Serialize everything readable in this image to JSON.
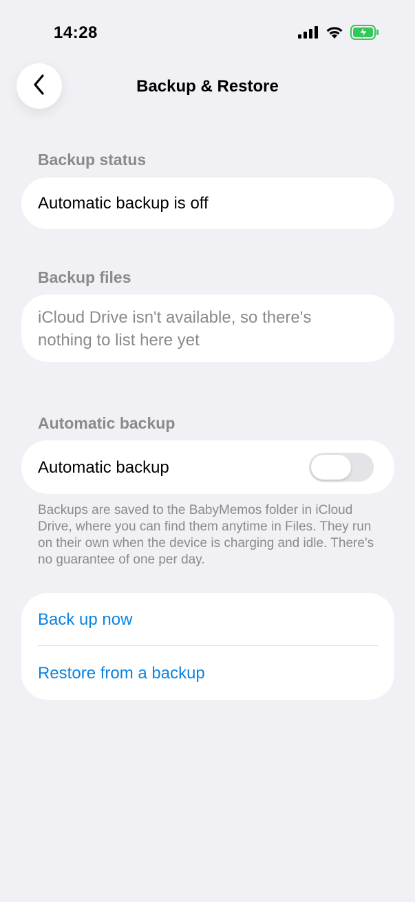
{
  "status_bar": {
    "time": "14:28",
    "icons": [
      "signal-icon",
      "wifi-icon",
      "battery-charging-icon"
    ],
    "battery_color": "#34c759"
  },
  "nav": {
    "title": "Backup & Restore",
    "back_icon": "chevron-left-icon"
  },
  "sections": {
    "backup_status": {
      "header": "Backup status",
      "value": "Automatic backup is off"
    },
    "backup_files": {
      "header": "Backup files",
      "empty_message": "iCloud Drive isn't available, so there's nothing to list here yet"
    },
    "automatic_backup": {
      "header": "Automatic backup",
      "toggle_label": "Automatic backup",
      "toggle_on": false,
      "footnote": "Backups are saved to the BabyMemos folder in iCloud Drive, where you can find them anytime in Files. They run on their own when the device is charging and idle. There's no guarantee of one per day."
    },
    "actions": {
      "back_up_now": "Back up now",
      "restore": "Restore from a backup"
    }
  },
  "colors": {
    "background": "#f0f0f5",
    "accent": "#0a84e0",
    "muted_text": "#8a8a8e"
  }
}
